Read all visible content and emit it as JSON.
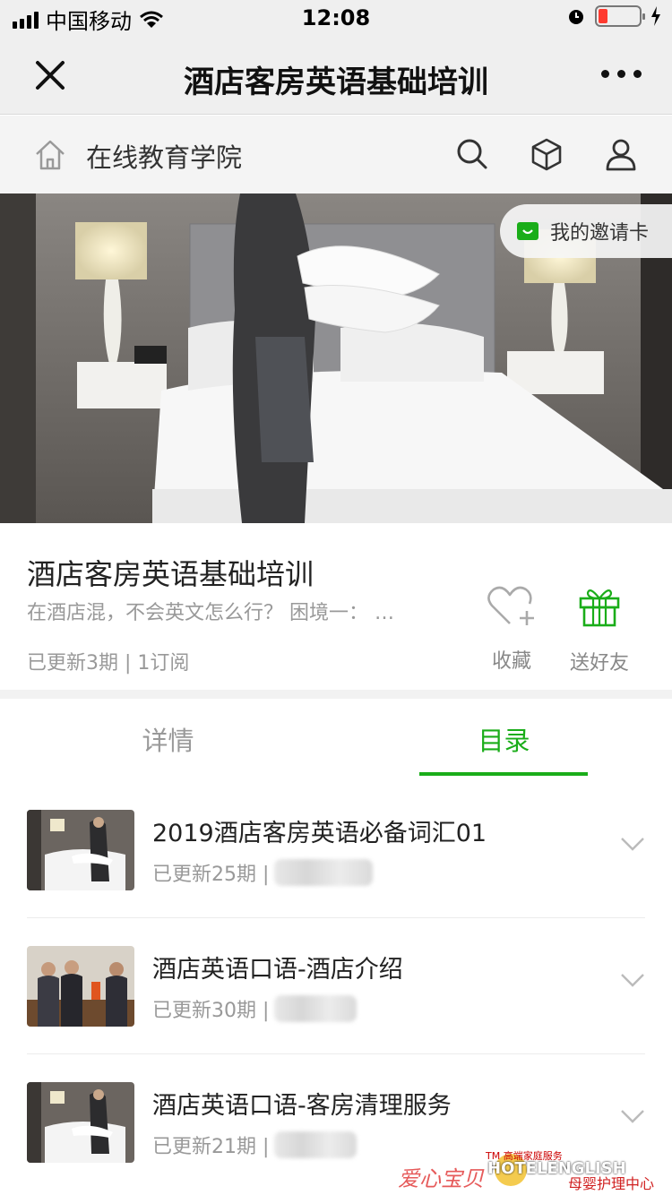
{
  "status_bar": {
    "carrier": "中国移动",
    "time": "12:08"
  },
  "navbar": {
    "title": "酒店客房英语基础培训"
  },
  "subbar": {
    "title": "在线教育学院"
  },
  "hero": {
    "invite_label": "我的邀请卡"
  },
  "course": {
    "title": "酒店客房英语基础培训",
    "description": "在酒店混，不会英文怎么行？ 困境一： …",
    "meta": "已更新3期 | 1订阅",
    "actions": [
      {
        "label": "收藏",
        "icon": "heart-plus-icon"
      },
      {
        "label": "送好友",
        "icon": "gift-icon"
      }
    ]
  },
  "tabs": [
    {
      "label": "详情",
      "active": false
    },
    {
      "label": "目录",
      "active": true
    }
  ],
  "catalog": [
    {
      "title": "2019酒店客房英语必备词汇01",
      "meta": "已更新25期 |"
    },
    {
      "title": "酒店英语口语-酒店介绍",
      "meta": "已更新30期 |"
    },
    {
      "title": "酒店英语口语-客房清理服务",
      "meta": "已更新21期 |"
    }
  ],
  "watermark": {
    "tm": "TM 高端家庭服务",
    "en": "HOTELENGLISH",
    "cn_left": "爱心宝贝",
    "cn_right": "母婴护理中心"
  },
  "colors": {
    "accent": "#1aad19",
    "battery_low": "#ff3b30"
  }
}
